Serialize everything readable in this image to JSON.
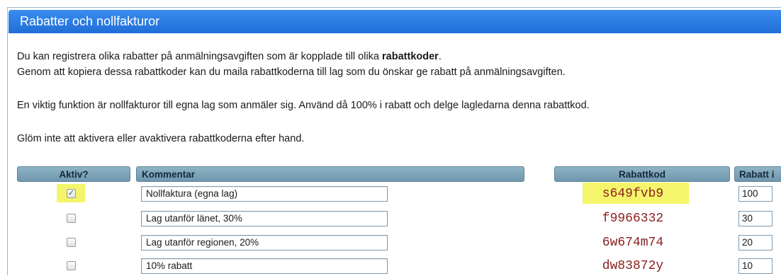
{
  "panel": {
    "title": "Rabatter och nollfakturor"
  },
  "description": {
    "line1_pre": "Du kan registrera olika rabatter på anmälningsavgiften som är kopplade till olika ",
    "line1_bold": "rabattkoder",
    "line1_post": ".",
    "line2": "Genom att kopiera dessa rabattkoder kan du maila rabattkoderna till lag som du önskar ge rabatt på anmälningsavgiften.",
    "line3": "En viktig funktion är nollfakturor till egna lag som anmäler sig. Använd då 100% i rabatt och delge lagledarna denna rabattkod.",
    "line4": "Glöm inte att aktivera eller avaktivera rabattkoderna efter hand."
  },
  "table": {
    "headers": {
      "active": "Aktiv?",
      "comment": "Kommentar",
      "code": "Rabattkod",
      "discount": "Rabatt i"
    },
    "rows": [
      {
        "active": true,
        "comment": "Nollfaktura (egna lag)",
        "code": "s649fvb9",
        "discount": "100",
        "highlighted": true
      },
      {
        "active": false,
        "comment": "Lag utanför länet, 30%",
        "code": "f9966332",
        "discount": "30",
        "highlighted": false
      },
      {
        "active": false,
        "comment": "Lag utanför regionen, 20%",
        "code": "6w674m74",
        "discount": "20",
        "highlighted": false
      },
      {
        "active": false,
        "comment": "10% rabatt",
        "code": "dw83872y",
        "discount": "10",
        "highlighted": false
      }
    ]
  },
  "colors": {
    "header_blue": "#2b7de0",
    "column_header": "#7fa6bb",
    "code_text": "#8a1f1f",
    "highlight": "#f4f56a"
  }
}
